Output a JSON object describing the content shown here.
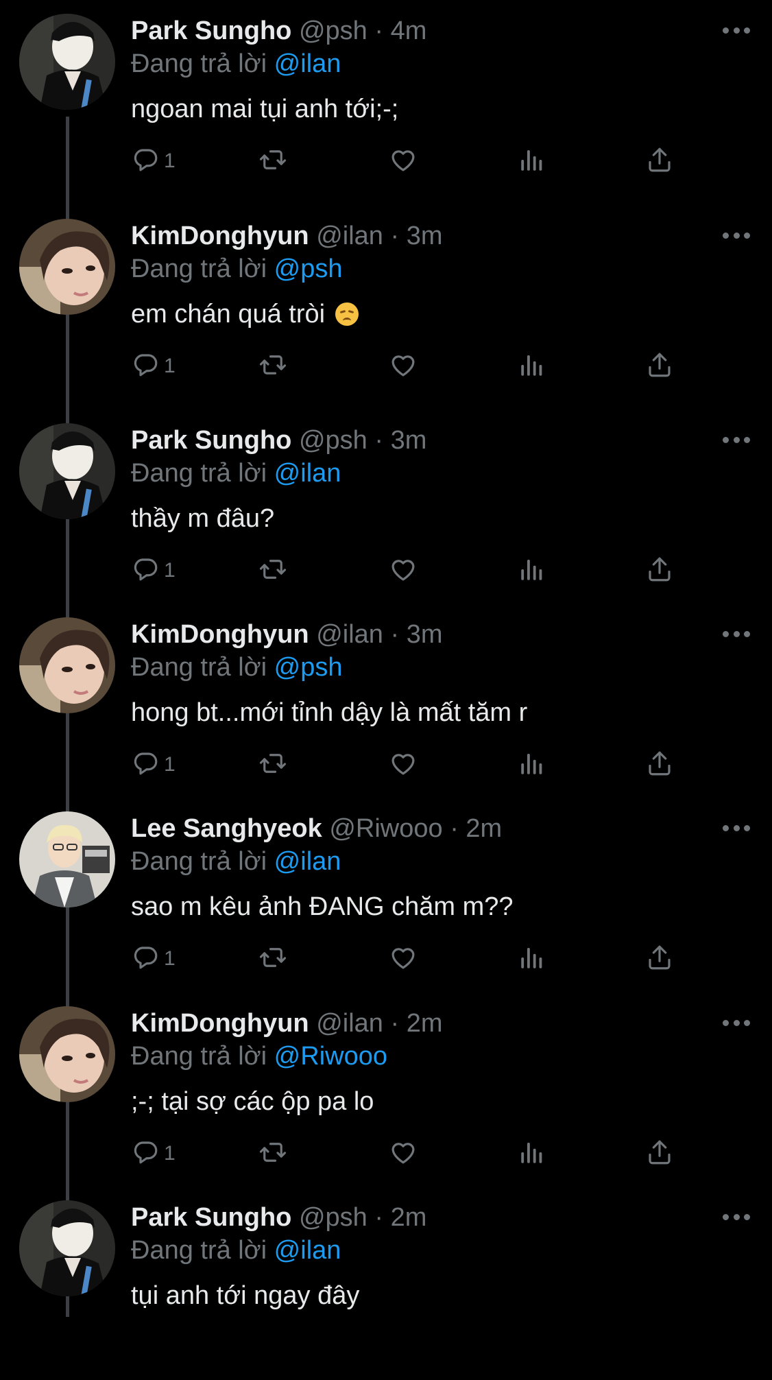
{
  "reply_prefix": "Đang trả lời",
  "icons": {
    "reply": "reply-icon",
    "retweet": "retweet-icon",
    "like": "like-icon",
    "views": "views-icon",
    "share": "share-icon",
    "more": "more-icon"
  },
  "colors": {
    "background": "#000000",
    "mention": "#1d9bf0",
    "secondary": "#71767b",
    "primary_text": "#e7e9ea"
  },
  "tweets": [
    {
      "name": "Park Sungho",
      "handle": "@psh",
      "time": "4m",
      "reply_to": "@ilan",
      "text": "ngoan mai tụi anh tới;-;",
      "reply_count": "1",
      "avatar": "park"
    },
    {
      "name": "KimDonghyun",
      "handle": "@ilan",
      "time": "3m",
      "reply_to": "@psh",
      "text": "em chán quá tròi",
      "emoji": "disappointed-face",
      "reply_count": "1",
      "avatar": "kim"
    },
    {
      "name": "Park Sungho",
      "handle": "@psh",
      "time": "3m",
      "reply_to": "@ilan",
      "text": "thầy m đâu?",
      "reply_count": "1",
      "avatar": "park"
    },
    {
      "name": "KimDonghyun",
      "handle": "@ilan",
      "time": "3m",
      "reply_to": "@psh",
      "text": "hong bt...mới tỉnh dậy là mất tăm r",
      "reply_count": "1",
      "avatar": "kim"
    },
    {
      "name": "Lee Sanghyeok",
      "handle": "@Riwooo",
      "time": "2m",
      "reply_to": "@ilan",
      "text": "sao m kêu ảnh ĐANG chăm m??",
      "reply_count": "1",
      "avatar": "lee"
    },
    {
      "name": "KimDonghyun",
      "handle": "@ilan",
      "time": "2m",
      "reply_to": "@Riwooo",
      "text": ";-; tại sợ các ộp pa lo",
      "reply_count": "1",
      "avatar": "kim"
    },
    {
      "name": "Park Sungho",
      "handle": "@psh",
      "time": "2m",
      "reply_to": "@ilan",
      "text": "tụi anh tới ngay đây",
      "reply_count": "",
      "avatar": "park"
    }
  ]
}
